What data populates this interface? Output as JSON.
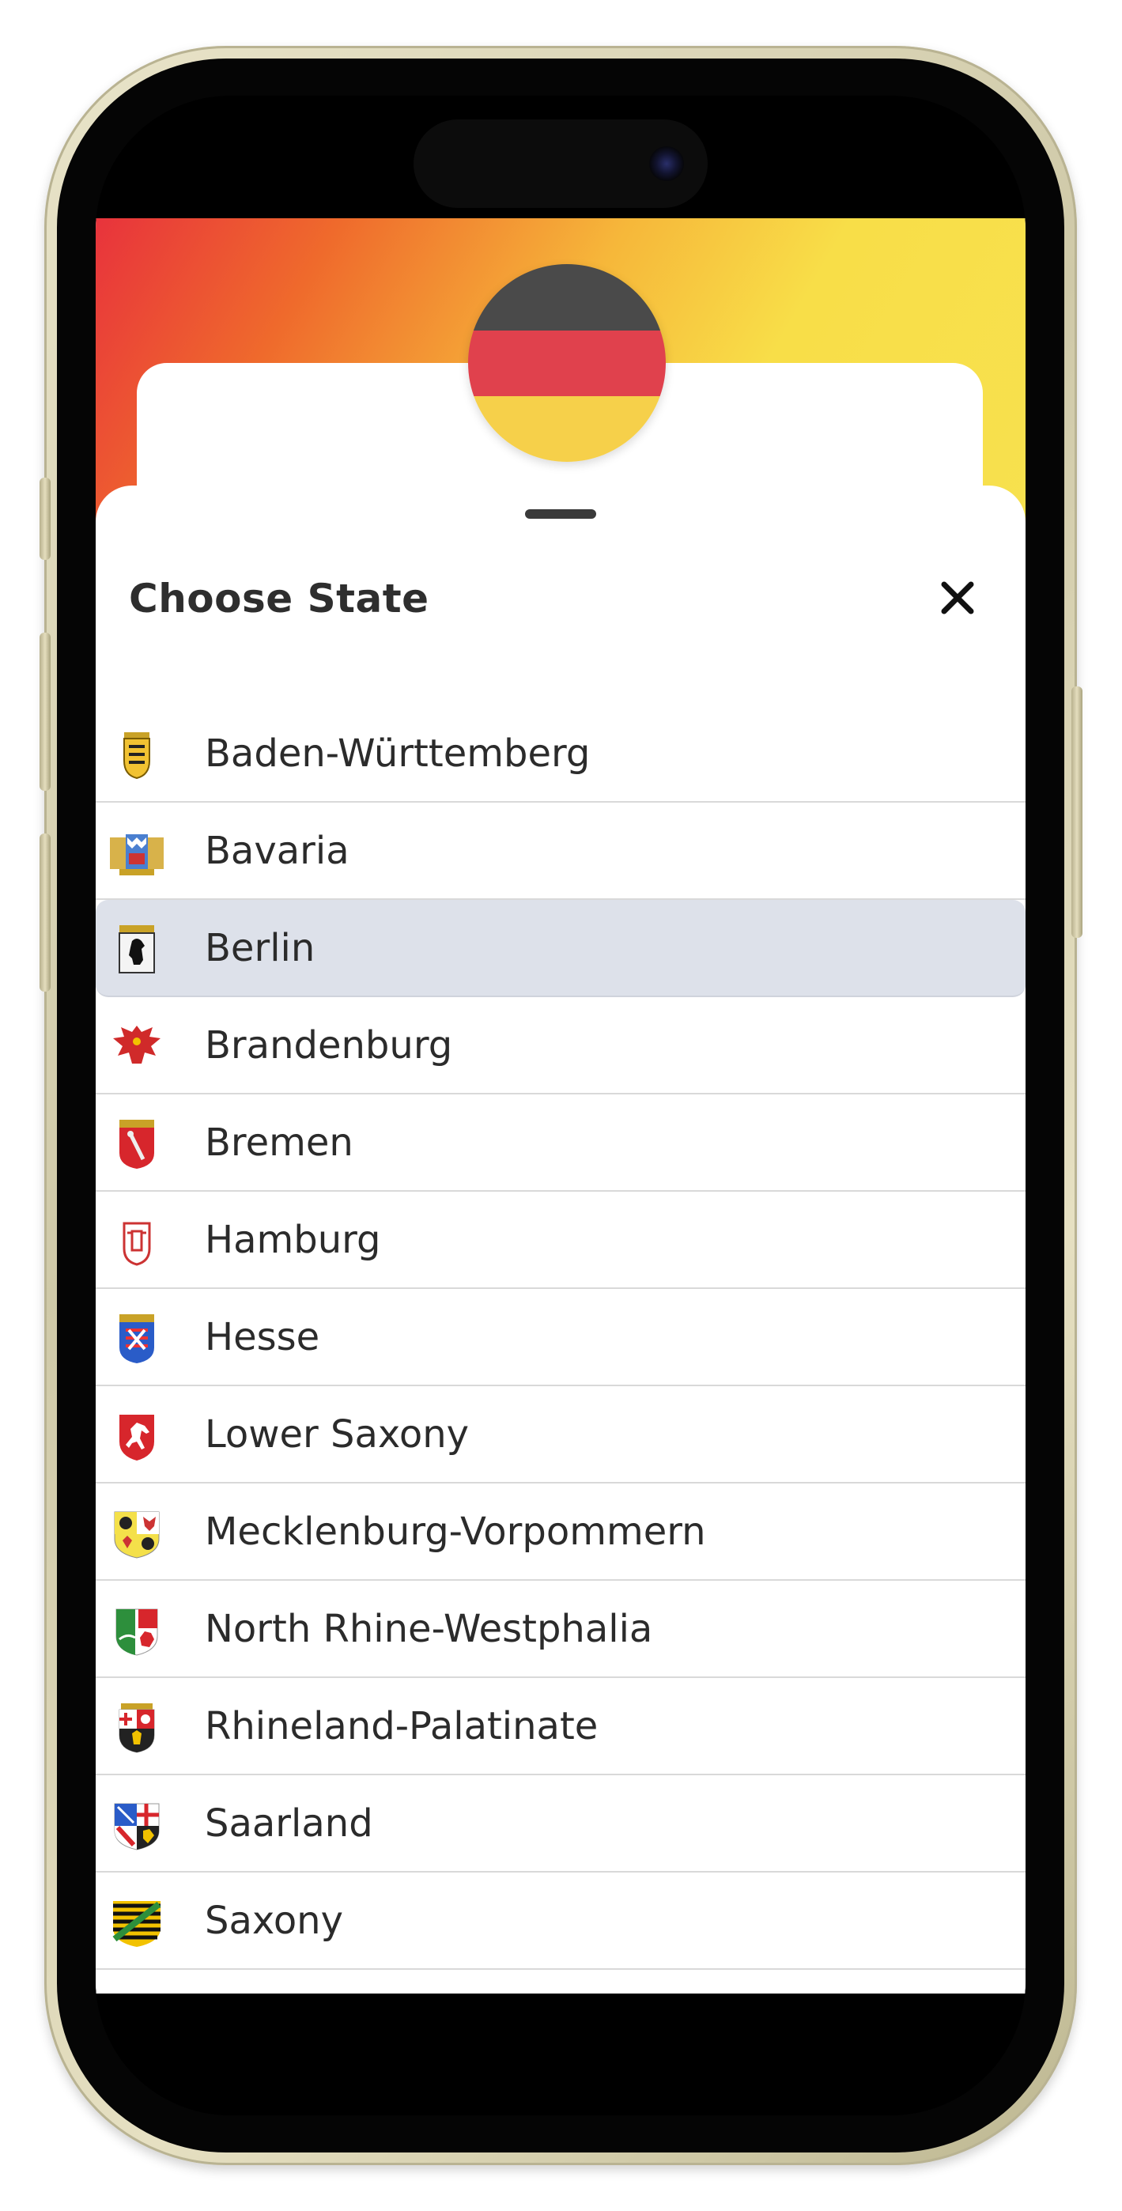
{
  "sheet": {
    "title": "Choose State",
    "close_label": "×"
  },
  "flag_colors": [
    "#4a4a4a",
    "#e0414d",
    "#f6d04a"
  ],
  "states": [
    {
      "label": "Baden-Württemberg",
      "icon": "baden-wurttemberg-coat-of-arms-icon",
      "selected": false
    },
    {
      "label": "Bavaria",
      "icon": "bavaria-coat-of-arms-icon",
      "selected": false
    },
    {
      "label": "Berlin",
      "icon": "berlin-coat-of-arms-icon",
      "selected": true
    },
    {
      "label": "Brandenburg",
      "icon": "brandenburg-coat-of-arms-icon",
      "selected": false
    },
    {
      "label": "Bremen",
      "icon": "bremen-coat-of-arms-icon",
      "selected": false
    },
    {
      "label": "Hamburg",
      "icon": "hamburg-coat-of-arms-icon",
      "selected": false
    },
    {
      "label": "Hesse",
      "icon": "hesse-coat-of-arms-icon",
      "selected": false
    },
    {
      "label": "Lower Saxony",
      "icon": "lower-saxony-coat-of-arms-icon",
      "selected": false
    },
    {
      "label": "Mecklenburg-Vorpommern",
      "icon": "mecklenburg-vorpommern-coat-of-arms-icon",
      "selected": false
    },
    {
      "label": "North Rhine-Westphalia",
      "icon": "north-rhine-westphalia-coat-of-arms-icon",
      "selected": false
    },
    {
      "label": "Rhineland-Palatinate",
      "icon": "rhineland-palatinate-coat-of-arms-icon",
      "selected": false
    },
    {
      "label": "Saarland",
      "icon": "saarland-coat-of-arms-icon",
      "selected": false
    },
    {
      "label": "Saxony",
      "icon": "saxony-coat-of-arms-icon",
      "selected": false
    }
  ],
  "colors": {
    "selected_row": "#dde1ea",
    "divider": "#d9d9d9",
    "text": "#2b2b2b"
  }
}
